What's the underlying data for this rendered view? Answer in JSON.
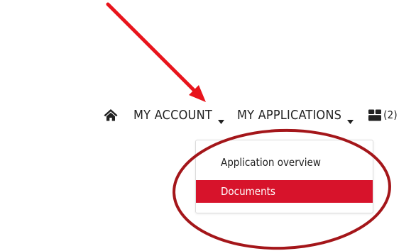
{
  "nav": {
    "home_icon": "home-icon",
    "account_label": "MY ACCOUNT",
    "applications_label": "MY APPLICATIONS",
    "cart_icon": "cart-icon",
    "cart_count": "(2)"
  },
  "dropdown": {
    "items": [
      {
        "label": "Application overview",
        "active": false
      },
      {
        "label": "Documents",
        "active": true
      }
    ]
  },
  "colors": {
    "active_item_bg": "#d7132b",
    "annotation_arrow": "#e8141c",
    "annotation_ellipse": "#a4161a",
    "text": "#222222"
  }
}
